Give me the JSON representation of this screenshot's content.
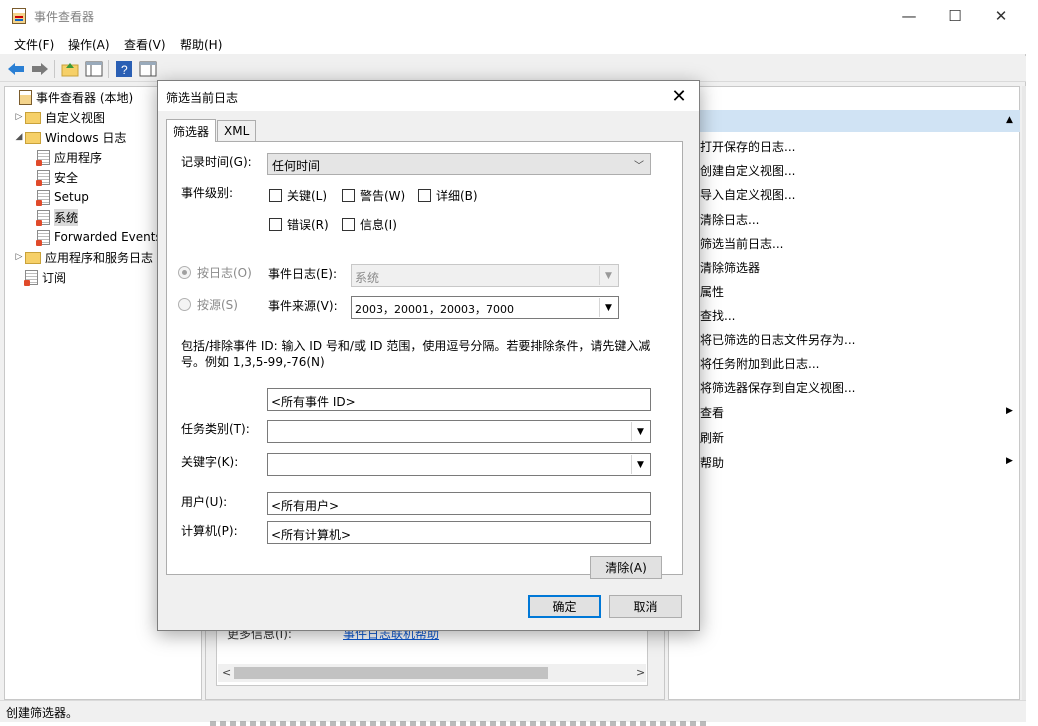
{
  "window": {
    "title": "事件查看器",
    "controls": {
      "minimize": "—",
      "maximize": "☐",
      "close": "✕"
    }
  },
  "menu": [
    "文件(F)",
    "操作(A)",
    "查看(V)",
    "帮助(H)"
  ],
  "tree": {
    "root": "事件查看器 (本地)",
    "custom_views": "自定义视图",
    "windows_logs": "Windows 日志",
    "logs": [
      "应用程序",
      "安全",
      "Setup",
      "系统",
      "Forwarded Events"
    ],
    "app_service_logs": "应用程序和服务日志",
    "subscriptions": "订阅"
  },
  "center": {
    "more_info_label": "更多信息(I):",
    "more_info_link": "事件日志联机帮助"
  },
  "actions": {
    "items": [
      "打开保存的日志...",
      "创建自定义视图...",
      "导入自定义视图...",
      "清除日志...",
      "筛选当前日志...",
      "清除筛选器",
      "属性",
      "查找...",
      "将已筛选的日志文件另存为...",
      "将任务附加到此日志...",
      "将筛选器保存到自定义视图...",
      "查看",
      "刷新",
      "帮助"
    ],
    "submenu_arrow": "▶"
  },
  "status": "创建筛选器。",
  "dialog": {
    "title": "筛选当前日志",
    "close": "✕",
    "tabs": [
      "筛选器",
      "XML"
    ],
    "logged_label": "记录时间(G):",
    "logged_value": "任何时间",
    "level_label": "事件级别:",
    "levels": [
      "关键(L)",
      "警告(W)",
      "详细(B)",
      "错误(R)",
      "信息(I)"
    ],
    "by_log_label": "按日志(O)",
    "by_source_label": "按源(S)",
    "event_logs_label": "事件日志(E):",
    "event_logs_value": "系统",
    "event_sources_label": "事件来源(V):",
    "event_sources_value": "2003，20001，20003，7000",
    "id_hint": "包括/排除事件 ID: 输入 ID 号和/或 ID 范围，使用逗号分隔。若要排除条件，请先键入减号。例如 1,3,5-99,-76(N)",
    "event_id_value": "<所有事件 ID>",
    "task_category_label": "任务类别(T):",
    "keywords_label": "关键字(K):",
    "user_label": "用户(U):",
    "user_value": "<所有用户>",
    "computer_label": "计算机(P):",
    "computer_value": "<所有计算机>",
    "clear_button": "清除(A)",
    "ok_button": "确定",
    "cancel_button": "取消"
  }
}
